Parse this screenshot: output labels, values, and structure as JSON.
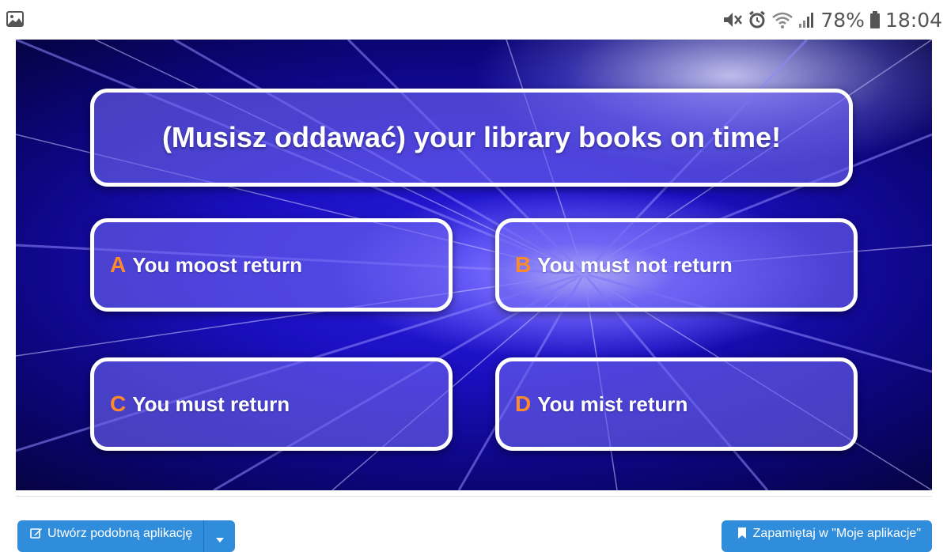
{
  "statusbar": {
    "battery": "78%",
    "time": "18:04"
  },
  "quiz": {
    "question": "(Musisz oddawać) your library books on time!",
    "answers": [
      {
        "letter": "A",
        "text": "You moost return"
      },
      {
        "letter": "B",
        "text": "You must not return"
      },
      {
        "letter": "C",
        "text": "You must return"
      },
      {
        "letter": "D",
        "text": "You mist return"
      }
    ]
  },
  "footer": {
    "create_label": "Utwórz podobną aplikację",
    "save_label": "Zapamiętaj w \"Moje aplikacje\""
  },
  "colors": {
    "accent_letter": "#ff8a2a",
    "button_blue": "#2f8ddc"
  }
}
